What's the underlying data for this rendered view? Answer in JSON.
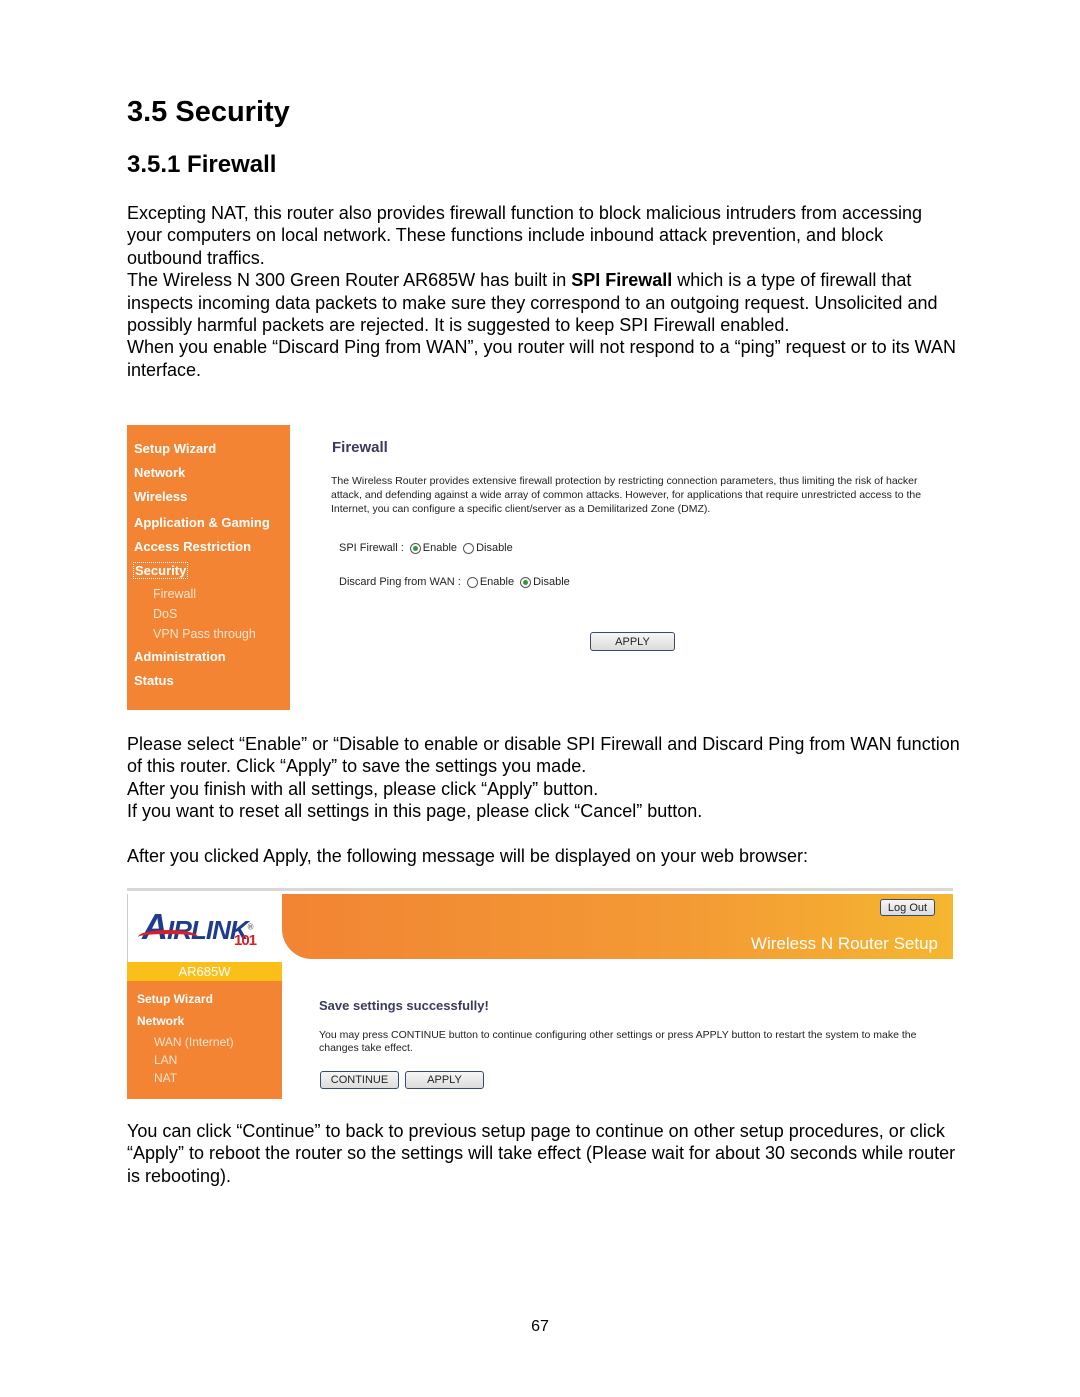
{
  "page": {
    "section_title": "3.5 Security",
    "subsection_title": "3.5.1 Firewall",
    "page_number": "67"
  },
  "intro": {
    "p1": "Excepting NAT, this router also provides firewall function to block malicious intruders from accessing your computers on local network. These functions include inbound attack prevention, and block outbound traffics.",
    "p2_before": "The Wireless N 300 Green Router AR685W has built in ",
    "p2_bold": "SPI Firewall",
    "p2_after": " which is a type of firewall that inspects incoming data packets to make sure they correspond to an outgoing request. Unsolicited and possibly harmful packets are rejected. It is suggested to keep SPI Firewall enabled.",
    "p3": "When you enable “Discard Ping from WAN”, you router will not respond to a “ping” request or to its WAN interface."
  },
  "firewall_screenshot": {
    "sidebar": {
      "items": [
        {
          "label": "Setup Wizard"
        },
        {
          "label": "Network"
        },
        {
          "label": "Wireless"
        },
        {
          "label": "Application & Gaming"
        },
        {
          "label": "Access Restriction"
        },
        {
          "label": "Security"
        },
        {
          "label": "Firewall"
        },
        {
          "label": "DoS"
        },
        {
          "label": "VPN Pass through"
        },
        {
          "label": "Administration"
        },
        {
          "label": "Status"
        }
      ]
    },
    "title": "Firewall",
    "description": "The Wireless Router provides extensive firewall protection by restricting connection parameters, thus limiting the risk of hacker attack, and defending against a wide array of common attacks. However, for applications that require unrestricted access to the Internet, you can configure a specific client/server as a Demilitarized Zone (DMZ).",
    "spi_label": "SPI Firewall :",
    "spi_enable": "Enable",
    "spi_disable": "Disable",
    "spi_value": "Enable",
    "ping_label": "Discard Ping from WAN :",
    "ping_enable": "Enable",
    "ping_disable": "Disable",
    "ping_value": "Disable",
    "apply_label": "APPLY"
  },
  "middle": {
    "p1": "Please select “Enable” or “Disable to enable or disable SPI Firewall and Discard Ping from WAN function of this router. Click “Apply” to save the settings you made.",
    "p2": "After you finish with all settings, please click “Apply” button.",
    "p3": "If you want to reset all settings in this page, please click “Cancel” button.",
    "p4": "After you clicked Apply, the following message will be displayed on your web browser:"
  },
  "save_screenshot": {
    "logo_text": "IRLINK",
    "logo_number": "101",
    "model": "AR685W",
    "banner_title": "Wireless N Router Setup",
    "logout_label": "Log Out",
    "sidebar": {
      "items": [
        {
          "label": "Setup Wizard"
        },
        {
          "label": "Network"
        },
        {
          "label": "WAN (Internet)"
        },
        {
          "label": "LAN"
        },
        {
          "label": "NAT"
        }
      ]
    },
    "title": "Save settings successfully!",
    "description": "You may press CONTINUE button to continue configuring other settings or press APPLY button to restart the system to make the changes take effect.",
    "continue_label": "CONTINUE",
    "apply_label": "APPLY"
  },
  "closing": {
    "p1": "You can click “Continue” to back to previous setup page to continue on other setup procedures, or click “Apply” to reboot the router so the settings will take effect (Please wait for about 30 seconds while router is rebooting)."
  },
  "colors": {
    "sidebar_orange": "#f28433",
    "model_yellow": "#fbbf19",
    "heading_navy": "#3a3a5e",
    "radio_green": "#2e9a3a"
  }
}
